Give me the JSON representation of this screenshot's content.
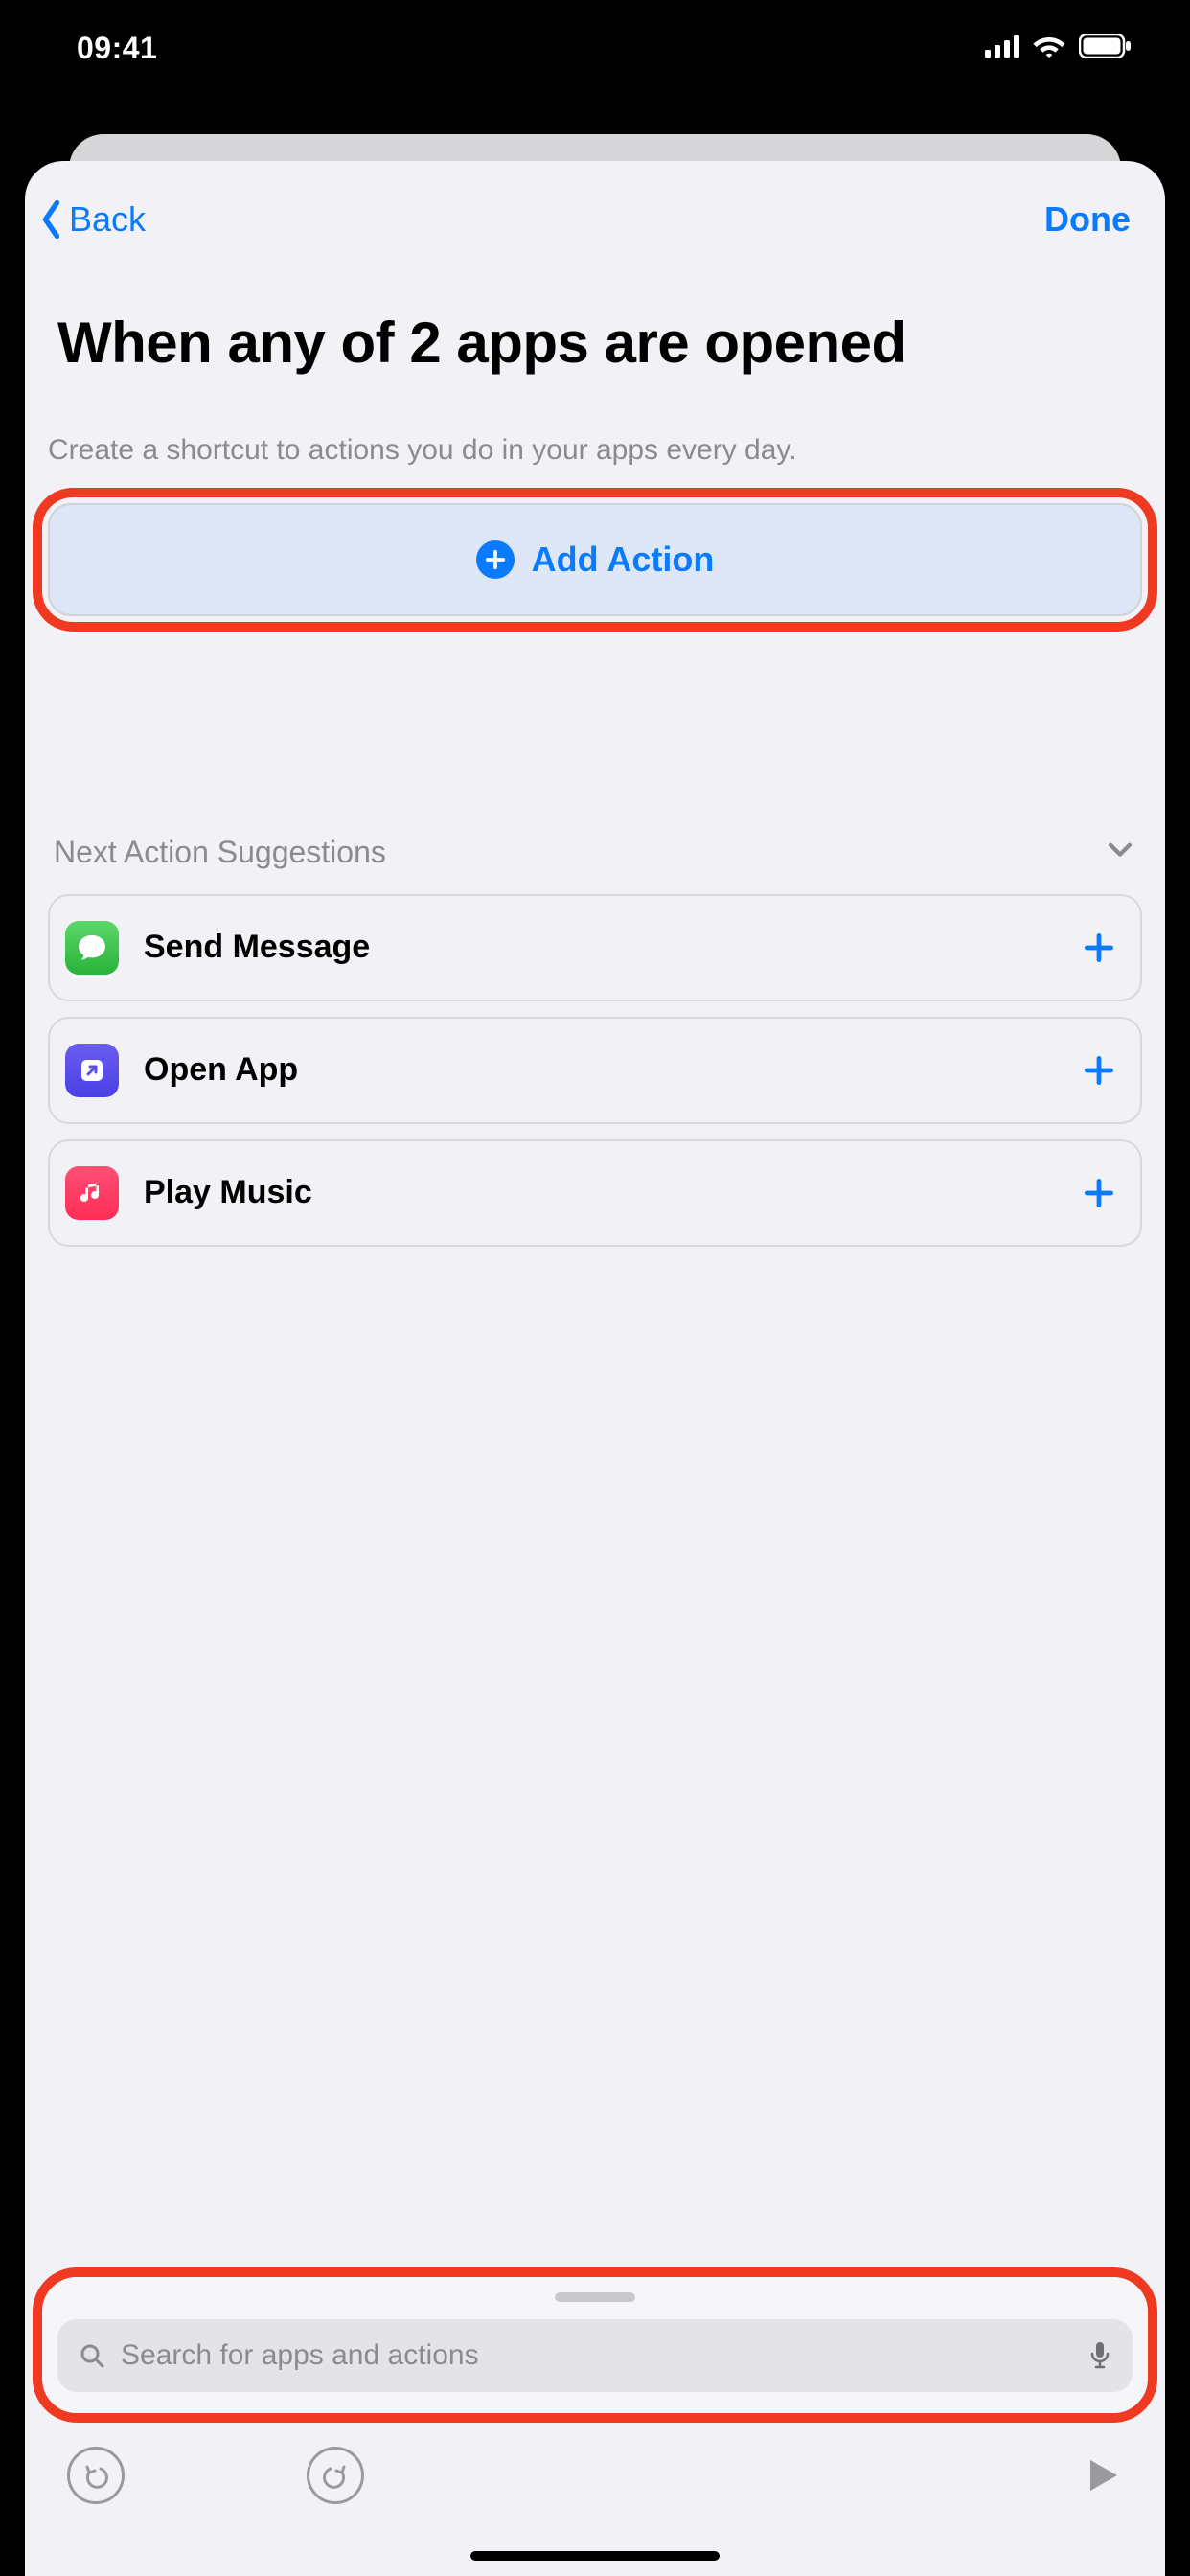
{
  "status": {
    "time": "09:41"
  },
  "nav": {
    "back_label": "Back",
    "done_label": "Done"
  },
  "header": {
    "title": "When any of 2 apps are opened",
    "subtitle": "Create a shortcut to actions you do in your apps every day."
  },
  "add_action": {
    "label": "Add Action"
  },
  "suggestions": {
    "header": "Next Action Suggestions",
    "items": [
      {
        "label": "Send Message",
        "icon": "messages-icon"
      },
      {
        "label": "Open App",
        "icon": "open-app-icon"
      },
      {
        "label": "Play Music",
        "icon": "music-icon"
      }
    ]
  },
  "search": {
    "placeholder": "Search for apps and actions"
  },
  "colors": {
    "accent": "#0a7aff",
    "highlight": "#ef3a21"
  }
}
